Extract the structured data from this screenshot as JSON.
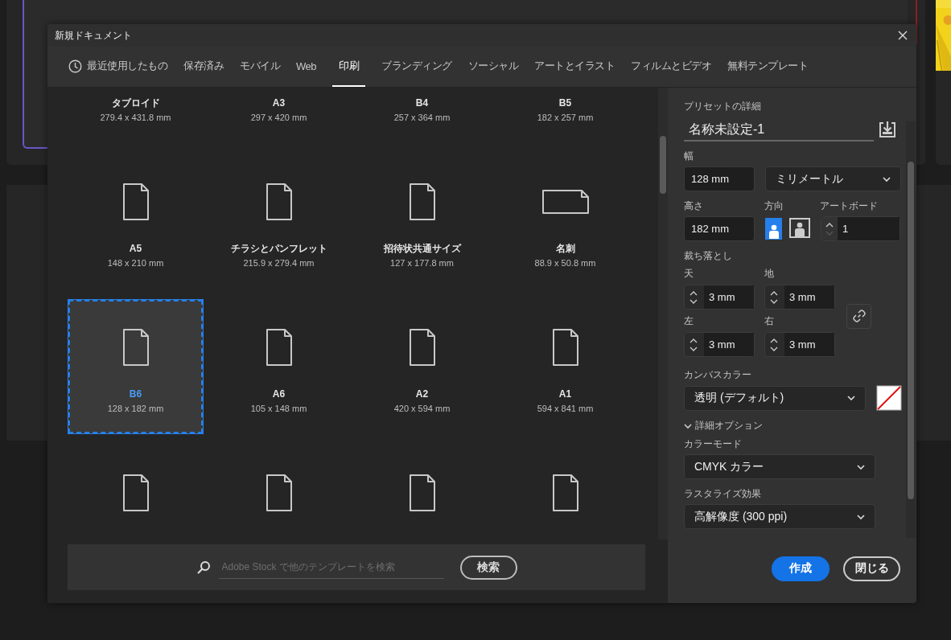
{
  "dialog": {
    "title": "新規ドキュメント",
    "tabs": [
      {
        "label": "最近使用したもの",
        "kind": "recent",
        "selected": false
      },
      {
        "label": "保存済み",
        "kind": "plain",
        "selected": false
      },
      {
        "label": "モバイル",
        "kind": "plain",
        "selected": false
      },
      {
        "label": "Web",
        "kind": "plain",
        "selected": false
      },
      {
        "label": "印刷",
        "kind": "plain",
        "selected": true
      },
      {
        "label": "ブランディング",
        "kind": "plain",
        "selected": false
      },
      {
        "label": "ソーシャル",
        "kind": "plain",
        "selected": false
      },
      {
        "label": "アートとイラスト",
        "kind": "plain",
        "selected": false
      },
      {
        "label": "フィルムとビデオ",
        "kind": "plain",
        "selected": false
      },
      {
        "label": "無料テンプレート",
        "kind": "plain",
        "selected": false
      }
    ],
    "presets": [
      {
        "name": "タブロイド",
        "size": "279.4 x 431.8 mm",
        "selected": false
      },
      {
        "name": "A3",
        "size": "297 x 420 mm",
        "selected": false
      },
      {
        "name": "B4",
        "size": "257 x 364 mm",
        "selected": false
      },
      {
        "name": "B5",
        "size": "182 x 257 mm",
        "selected": false
      },
      {
        "name": "A5",
        "size": "148 x 210 mm",
        "kind": "portrait",
        "selected": false
      },
      {
        "name": "チラシとパンフレット",
        "size": "215.9 x 279.4 mm",
        "kind": "portrait",
        "selected": false
      },
      {
        "name": "招待状共通サイズ",
        "size": "127 x 177.8 mm",
        "kind": "portrait",
        "selected": false
      },
      {
        "name": "名刺",
        "size": "88.9 x 50.8 mm",
        "kind": "landscape",
        "selected": false
      },
      {
        "name": "B6",
        "size": "128 x 182 mm",
        "kind": "portrait",
        "selected": true
      },
      {
        "name": "A6",
        "size": "105 x 148 mm",
        "kind": "portrait",
        "selected": false
      },
      {
        "name": "A2",
        "size": "420 x 594 mm",
        "kind": "portrait",
        "selected": false
      },
      {
        "name": "A1",
        "size": "594 x 841 mm",
        "kind": "portrait",
        "selected": false
      },
      {
        "kind": "portrait",
        "selected": false
      },
      {
        "kind": "portrait",
        "selected": false
      },
      {
        "kind": "portrait",
        "selected": false
      },
      {
        "kind": "portrait",
        "selected": false
      }
    ],
    "search": {
      "placeholder": "Adobe Stock で他のテンプレートを検索",
      "button": "検索"
    },
    "details": {
      "title": "プリセットの詳細",
      "name": "名称未設定-1",
      "width_label": "幅",
      "width": "128 mm",
      "units": "ミリメートル",
      "height_label": "高さ",
      "height": "182 mm",
      "orientation_label": "方向",
      "orientation_buttons": [
        {
          "kind": "portrait",
          "selected": true
        },
        {
          "kind": "landscape",
          "selected": false
        }
      ],
      "artboards_label": "アートボード",
      "artboards": "1",
      "bleed_label": "裁ち落とし",
      "bleeds": [
        {
          "label": "天",
          "value": "3 mm"
        },
        {
          "label": "地",
          "value": "3 mm"
        },
        {
          "label": "左",
          "value": "3 mm"
        },
        {
          "label": "右",
          "value": "3 mm"
        }
      ],
      "canvas_color_label": "カンバスカラー",
      "canvas_color": "透明 (デフォルト)",
      "advanced_label": "詳細オプション",
      "advanced_expanded": true,
      "color_mode_label": "カラーモード",
      "color_mode": "CMYK カラー",
      "raster_label": "ラスタライズ効果",
      "raster": "高解像度 (300 ppi)"
    },
    "buttons": {
      "create": "作成",
      "close": "閉じる"
    }
  }
}
